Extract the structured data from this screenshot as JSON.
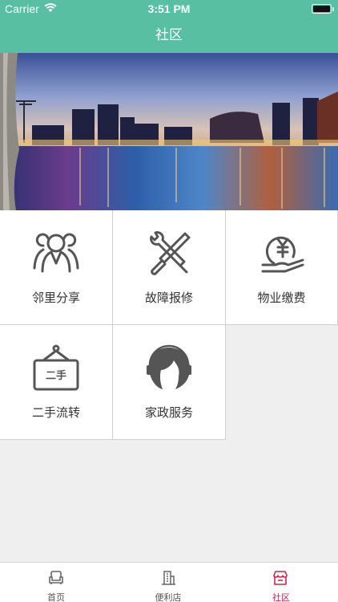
{
  "status_bar": {
    "carrier": "Carrier",
    "time": "3:51 PM"
  },
  "nav": {
    "title": "社区"
  },
  "tiles": [
    {
      "label": "邻里分享",
      "icon": "neighbors-icon"
    },
    {
      "label": "故障报修",
      "icon": "repair-tools-icon"
    },
    {
      "label": "物业缴费",
      "icon": "yen-payment-icon"
    },
    {
      "label": "二手流转",
      "icon": "secondhand-sign-icon",
      "sign_text": "二手"
    },
    {
      "label": "家政服务",
      "icon": "housekeeper-icon"
    }
  ],
  "tabbar": {
    "items": [
      {
        "label": "首页",
        "icon": "home-sofa-icon"
      },
      {
        "label": "便利店",
        "icon": "store-building-icon"
      },
      {
        "label": "社区",
        "icon": "community-shop-icon",
        "active": true
      }
    ]
  },
  "colors": {
    "accent": "#58bfa2",
    "active_tab": "#d4234f",
    "icon_gray": "#555555"
  }
}
